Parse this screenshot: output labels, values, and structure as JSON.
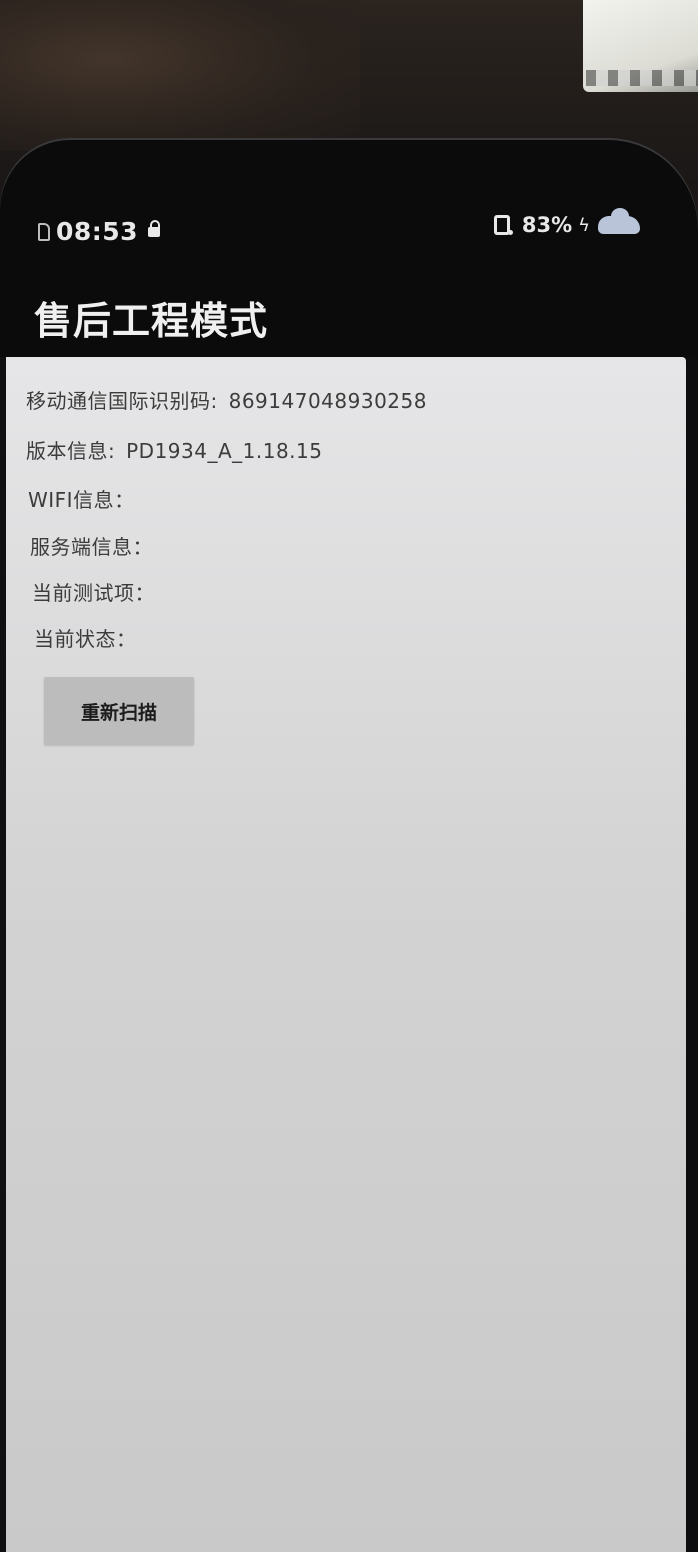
{
  "status_bar": {
    "time": "08:53",
    "battery_percent": "83%",
    "icons": [
      "sim-icon",
      "lock-icon",
      "nfc-icon",
      "charge-icon",
      "cloud-icon"
    ]
  },
  "app": {
    "title": "售后工程模式"
  },
  "info": {
    "imei_label": "移动通信国际识别码:",
    "imei_value": "869147048930258",
    "version_label": "版本信息:",
    "version_value": "PD1934_A_1.18.15",
    "wifi_label": "WIFI信息：",
    "server_label": "服务端信息：",
    "test_item_label": "当前测试项：",
    "status_label": "当前状态："
  },
  "actions": {
    "rescan_label": "重新扫描"
  }
}
